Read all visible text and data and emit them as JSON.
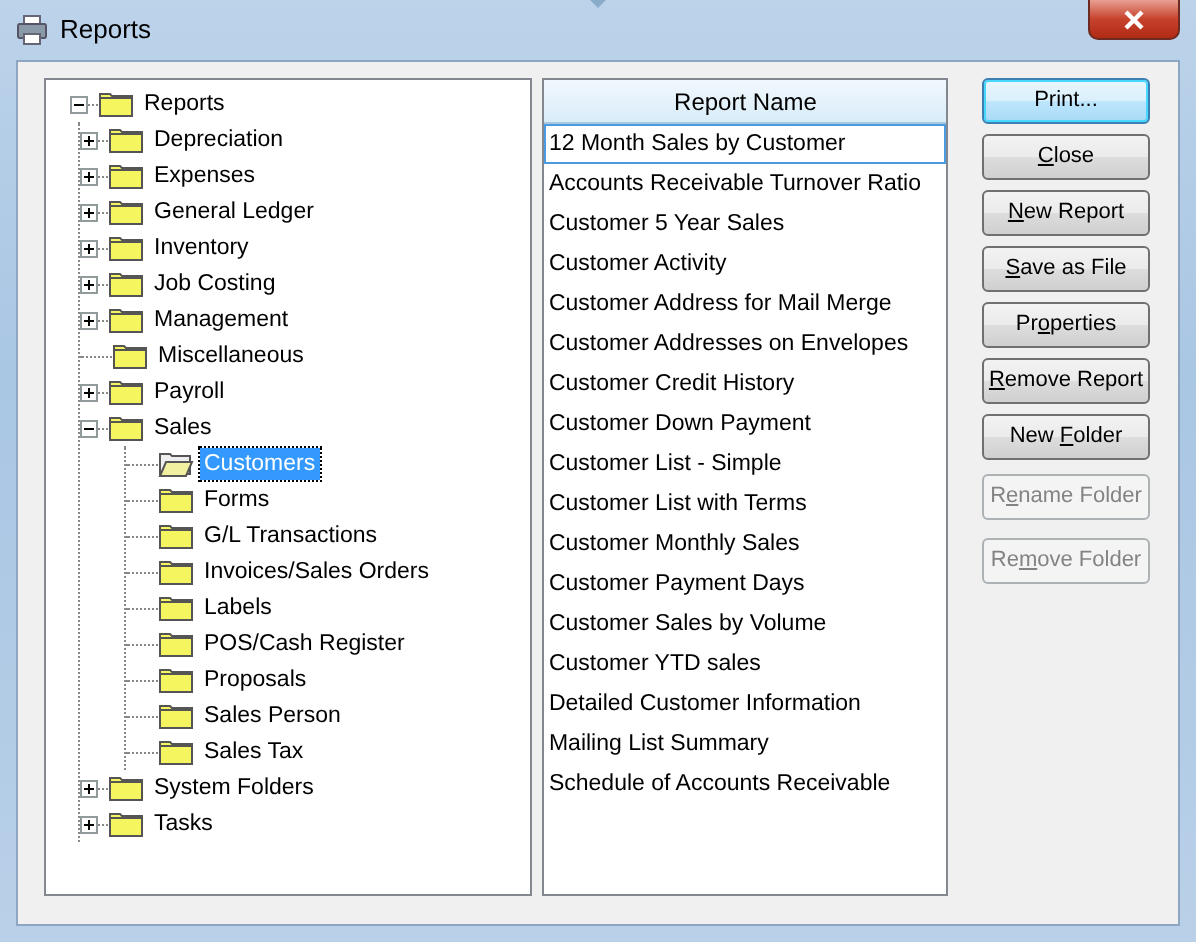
{
  "window": {
    "title": "Reports"
  },
  "tree": {
    "label": "Reports",
    "expanded": true,
    "children": [
      {
        "label": "Depreciation",
        "expanded": false,
        "selected": false
      },
      {
        "label": "Expenses",
        "expanded": false,
        "selected": false
      },
      {
        "label": "General Ledger",
        "expanded": false,
        "selected": false
      },
      {
        "label": "Inventory",
        "expanded": false,
        "selected": false
      },
      {
        "label": "Job Costing",
        "expanded": false,
        "selected": false
      },
      {
        "label": "Management",
        "expanded": false,
        "selected": false
      },
      {
        "label": "Miscellaneous",
        "selected": false
      },
      {
        "label": "Payroll",
        "expanded": false,
        "selected": false
      },
      {
        "label": "Sales",
        "expanded": true,
        "selected": false,
        "children": [
          {
            "label": "Customers",
            "selected": true
          },
          {
            "label": "Forms",
            "selected": false
          },
          {
            "label": "G/L Transactions",
            "selected": false
          },
          {
            "label": "Invoices/Sales Orders",
            "selected": false
          },
          {
            "label": "Labels",
            "selected": false
          },
          {
            "label": "POS/Cash Register",
            "selected": false
          },
          {
            "label": "Proposals",
            "selected": false
          },
          {
            "label": "Sales Person",
            "selected": false
          },
          {
            "label": "Sales Tax",
            "selected": false
          }
        ]
      },
      {
        "label": "System Folders",
        "expanded": false,
        "selected": false
      },
      {
        "label": "Tasks",
        "expanded": false,
        "selected": false
      }
    ]
  },
  "report_list": {
    "column": "Report Name",
    "rows": [
      {
        "name": "12 Month Sales by Customer",
        "focused": true
      },
      {
        "name": "Accounts Receivable Turnover Ratio",
        "focused": false
      },
      {
        "name": "Customer 5 Year Sales",
        "focused": false
      },
      {
        "name": "Customer Activity",
        "focused": false
      },
      {
        "name": "Customer Address for Mail Merge",
        "focused": false
      },
      {
        "name": "Customer Addresses on Envelopes",
        "focused": false
      },
      {
        "name": "Customer Credit History",
        "focused": false
      },
      {
        "name": "Customer Down Payment",
        "focused": false
      },
      {
        "name": "Customer List - Simple",
        "focused": false
      },
      {
        "name": "Customer List with Terms",
        "focused": false
      },
      {
        "name": "Customer Monthly Sales",
        "focused": false
      },
      {
        "name": "Customer Payment Days",
        "focused": false
      },
      {
        "name": "Customer Sales by Volume",
        "focused": false
      },
      {
        "name": "Customer YTD sales",
        "focused": false
      },
      {
        "name": "Detailed Customer Information",
        "focused": false
      },
      {
        "name": "Mailing List Summary",
        "focused": false
      },
      {
        "name": "Schedule of Accounts Receivable",
        "focused": false
      }
    ]
  },
  "buttons": [
    {
      "label": "Print...",
      "default": true,
      "disabled": false
    },
    {
      "key": "C",
      "post": "lose",
      "default": false,
      "disabled": false
    },
    {
      "key": "N",
      "post": "ew Report",
      "default": false,
      "disabled": false
    },
    {
      "key": "S",
      "post": "ave as File",
      "default": false,
      "disabled": false
    },
    {
      "pre": "Pr",
      "key": "o",
      "post": "perties",
      "default": false,
      "disabled": false
    },
    {
      "key": "R",
      "post": "emove Report",
      "default": false,
      "disabled": false
    },
    {
      "pre": "New ",
      "key": "F",
      "post": "older",
      "default": false,
      "disabled": false
    },
    {
      "pre": "R",
      "key": "e",
      "post": "name Folder",
      "default": false,
      "disabled": true
    },
    {
      "pre": "Re",
      "key": "m",
      "post": "ove Folder",
      "default": false,
      "disabled": true
    }
  ]
}
